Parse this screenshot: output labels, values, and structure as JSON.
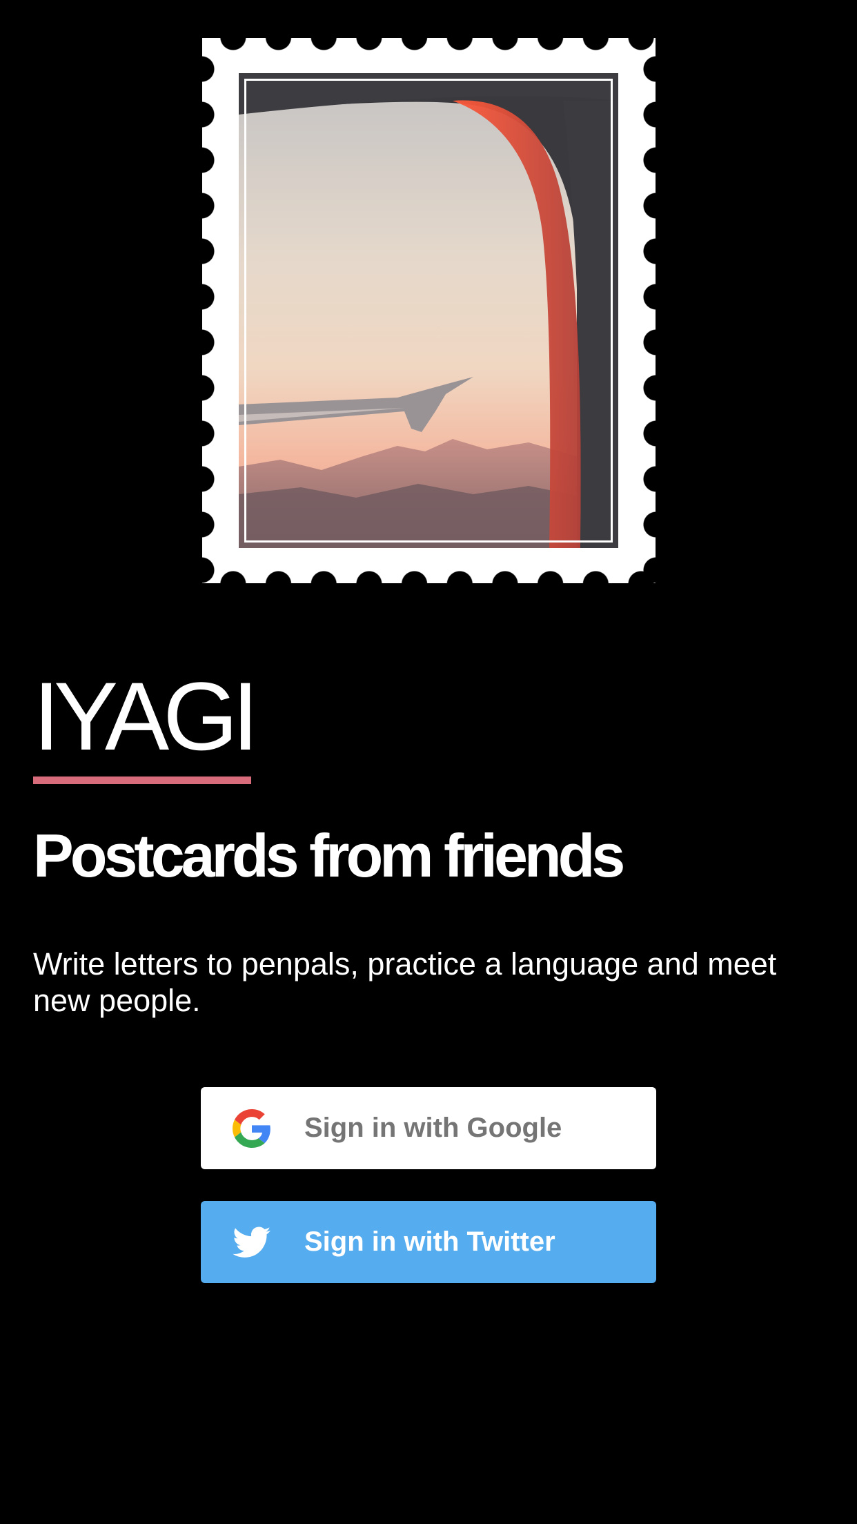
{
  "app": {
    "title": "IYAGI",
    "tagline": "Postcards from friends",
    "description": "Write letters to penpals, practice a language and meet new people."
  },
  "hero": {
    "image": "airplane-window-wing-sunset-stamp"
  },
  "auth": {
    "google": {
      "label": "Sign in with Google",
      "icon": "google-g-icon",
      "background": "#ffffff",
      "text_color": "#757575"
    },
    "twitter": {
      "label": "Sign in with Twitter",
      "icon": "twitter-bird-icon",
      "background": "#55acee",
      "text_color": "#ffffff"
    }
  },
  "colors": {
    "background": "#000000",
    "accent_underline": "#d96c7a"
  }
}
